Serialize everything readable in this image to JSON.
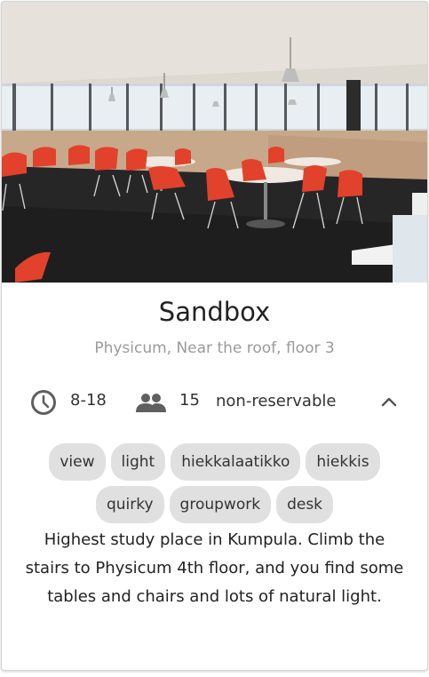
{
  "place": {
    "name": "Sandbox",
    "location": "Physicum, Near the roof, floor 3",
    "hours": "8-18",
    "capacity": "15",
    "reservation": "non-reservable",
    "tags": [
      "view",
      "light",
      "hiekkalaatikko",
      "hiekkis",
      "quirky",
      "groupwork",
      "desk"
    ],
    "description": "Highest study place in Kumpula. Climb the stairs to Physicum 4th floor, and you find some tables and chairs and lots of natural light."
  },
  "icons": {
    "hours": "clock-icon",
    "capacity": "people-icon",
    "toggle": "chevron-up-icon"
  },
  "colors": {
    "chair": "#e2412b",
    "tag_background": "#e0e0e0",
    "secondary_text": "#9a9a9a"
  }
}
